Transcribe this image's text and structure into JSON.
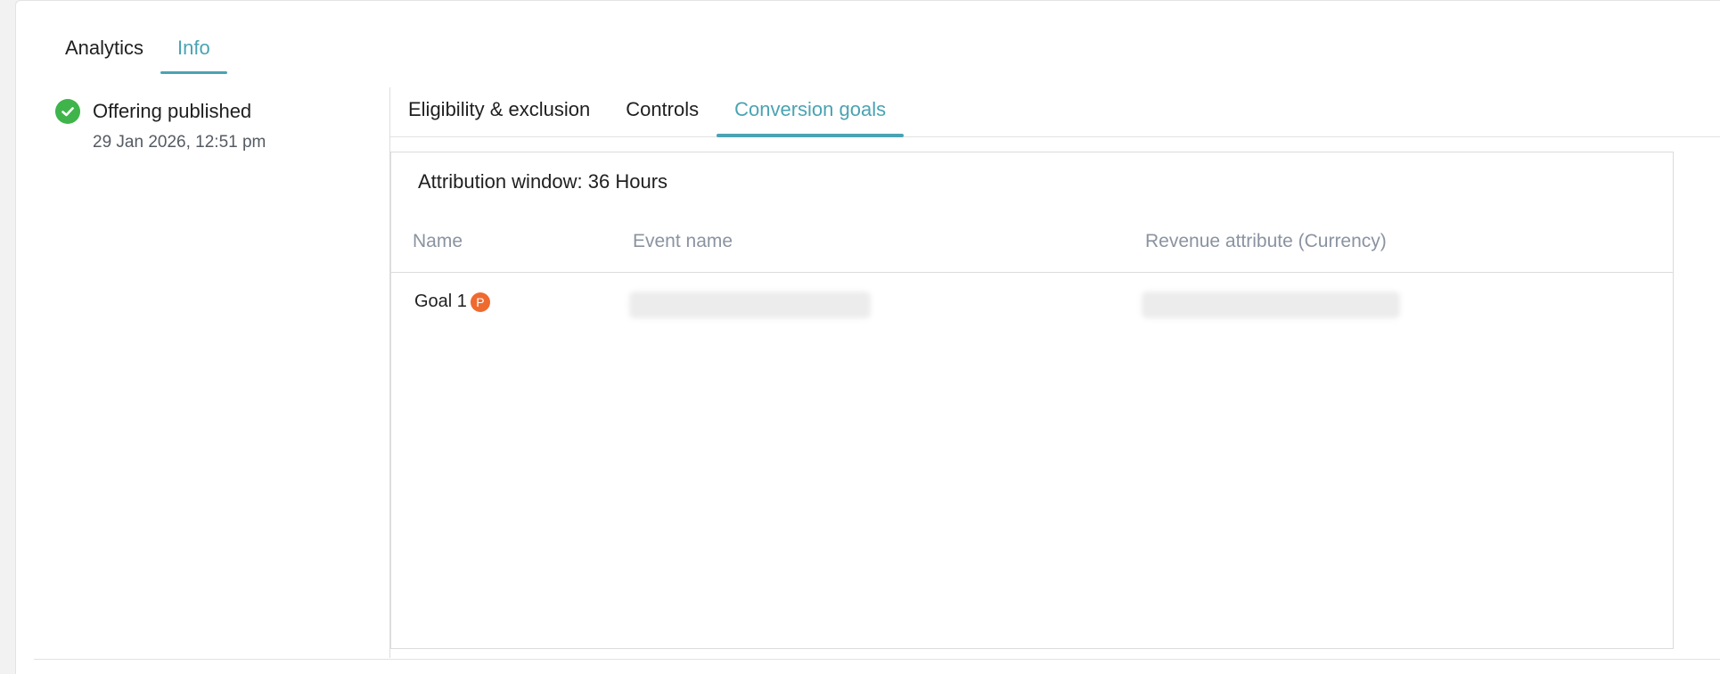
{
  "top_tabs": [
    {
      "label": "Analytics",
      "active": false
    },
    {
      "label": "Info",
      "active": true
    }
  ],
  "status": {
    "title": "Offering published",
    "date": "29 Jan 2026, 12:51 pm",
    "icon": "check-circle-icon",
    "color": "#3fb44b"
  },
  "sub_tabs": [
    {
      "label": "Eligibility & exclusion",
      "active": false
    },
    {
      "label": "Controls",
      "active": false
    },
    {
      "label": "Conversion goals",
      "active": true
    }
  ],
  "conversion_goals": {
    "attribution_window": "Attribution window: 36 Hours",
    "columns": [
      "Name",
      "Event name",
      "Revenue attribute (Currency)"
    ],
    "rows": [
      {
        "name": "Goal 1",
        "badge": "P",
        "event_name": "",
        "revenue_attribute": ""
      }
    ]
  },
  "colors": {
    "accent": "#4aa3b3",
    "badge": "#ef6a2e"
  }
}
